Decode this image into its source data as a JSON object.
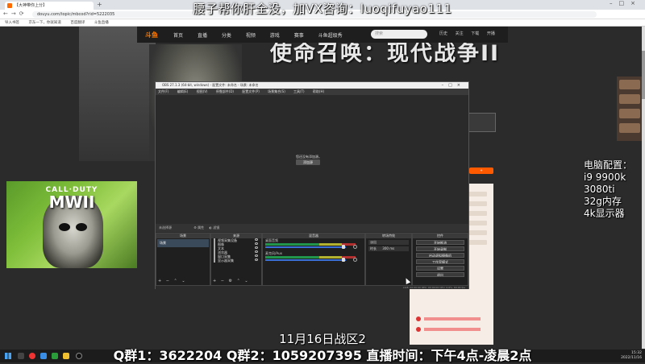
{
  "banner": "腰子帮你肝全没，加VX咨询：luoqifuyao111",
  "browser": {
    "tab_title": "【大神带你上分】",
    "url": "douyu.com/topic/mbcod?rid=5222035",
    "bookmarks": [
      "导入书签",
      "京东一下，你就知道",
      "百度翻译",
      "斗鱼直播"
    ]
  },
  "site_nav": {
    "logo": "斗鱼",
    "menu": [
      "首页",
      "直播",
      "分类",
      "视频",
      "游戏",
      "赛事",
      "斗鱼超级秀"
    ],
    "search_placeholder": "搜索",
    "icons": [
      "历史",
      "关注",
      "下载",
      "开播"
    ]
  },
  "page_title": "使命召唤：现代战争II",
  "cover": {
    "title": "CALL·DUTY",
    "mw": "MWII"
  },
  "specs": [
    "电脑配置：",
    "i9 9900k",
    "3080ti",
    "32g内存",
    "4k显示器"
  ],
  "obs": {
    "title": "OBS 27.1.3 (64-bit, windows) - 配置文件: 未命名 - 场景: 未命名",
    "menu": [
      "文件(F)",
      "编辑(E)",
      "视图(V)",
      "停靠部件(D)",
      "配置文件(P)",
      "场景集合(S)",
      "工具(T)",
      "帮助(H)"
    ],
    "no_source": "您还没有添加源。",
    "add_source": "添加源",
    "divider": "未选择源",
    "divider_props": "属性",
    "divider_filters": "滤镜",
    "panels": {
      "scenes": "场景",
      "sources": "来源",
      "mixer": "混音器",
      "transition": "转场特效",
      "controls": "控件"
    },
    "scene_items": [
      "场景"
    ],
    "source_items": [
      "视频采集设备",
      "图像",
      "文本",
      "浏览器",
      "窗口采集",
      "显示器采集"
    ],
    "mixer_channels": [
      {
        "name": "桌面音频"
      },
      {
        "name": "麦克风/Aux"
      }
    ],
    "transition": {
      "type": "淡出",
      "duration_label": "时长",
      "duration": "300 ms"
    },
    "controls": [
      "开始推流",
      "开始录制",
      "启动虚拟摄像机",
      "工作室模式",
      "设置",
      "退出"
    ],
    "status": "LIVE: 00:00:00   REC: 00:00:00   CPU: 0.6%, 60.00 fps"
  },
  "event": "11月16日战区2",
  "qq_line": "Q群1：3622204  Q群2：1059207395   直播时间：下午4点-凌晨2点",
  "taskbar": {
    "time": "15:32",
    "date": "2022/11/16"
  }
}
